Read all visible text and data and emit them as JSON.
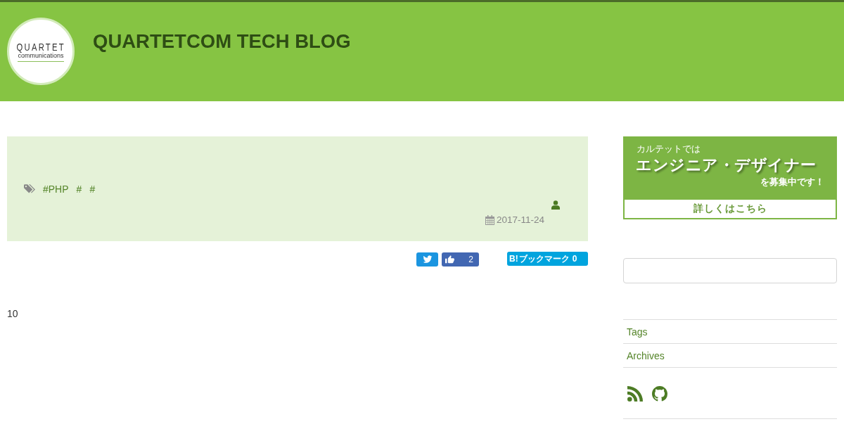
{
  "header": {
    "logo": {
      "wordmark": "QUARTET",
      "subline": "communications"
    },
    "title": "QUARTETCOM TECH BLOG"
  },
  "post": {
    "tags": [
      "#PHP",
      "#",
      "#"
    ],
    "date": "2017-11-24"
  },
  "share": {
    "like_count": "2",
    "bookmark": {
      "mark": "B!",
      "label": "ブックマーク",
      "count": "0"
    }
  },
  "body": {
    "text": "10"
  },
  "sidebar": {
    "banner": {
      "intro": "カルテットでは",
      "headline": "エンジニア・デザイナー",
      "outro": "を募集中です！",
      "link": "詳しくはこちら"
    },
    "links": [
      "Tags",
      "Archives"
    ],
    "social": [
      {
        "kind": "rss"
      },
      {
        "kind": "github"
      }
    ]
  }
}
